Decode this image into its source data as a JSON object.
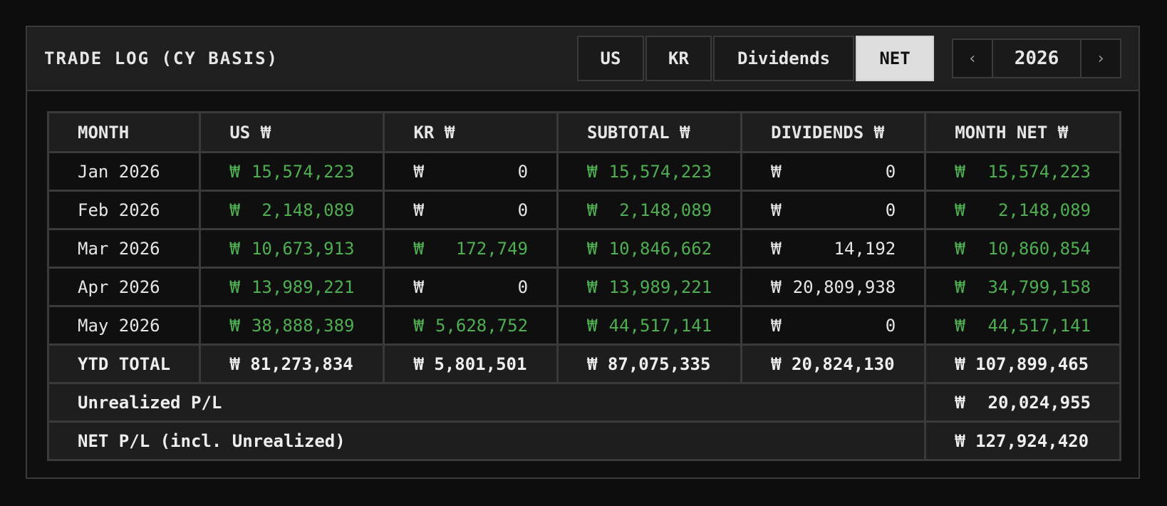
{
  "title": "TRADE LOG (CY BASIS)",
  "tabs": [
    {
      "label": "US",
      "active": false
    },
    {
      "label": "KR",
      "active": false
    },
    {
      "label": "Dividends",
      "active": false
    },
    {
      "label": "NET",
      "active": true
    }
  ],
  "year_nav": {
    "prev_icon": "‹",
    "year": "2026",
    "next_icon": "›"
  },
  "columns": [
    "MONTH",
    "US ₩",
    "KR ₩",
    "SUBTOTAL ₩",
    "DIVIDENDS ₩",
    "MONTH NET ₩"
  ],
  "currency_symbol": "₩",
  "rows": [
    {
      "month": "Jan 2026",
      "us": "15,574,223",
      "kr": "0",
      "subtotal": "15,574,223",
      "dividends": "0",
      "net": "15,574,223"
    },
    {
      "month": "Feb 2026",
      "us": "2,148,089",
      "kr": "0",
      "subtotal": "2,148,089",
      "dividends": "0",
      "net": "2,148,089"
    },
    {
      "month": "Mar 2026",
      "us": "10,673,913",
      "kr": "172,749",
      "subtotal": "10,846,662",
      "dividends": "14,192",
      "net": "10,860,854"
    },
    {
      "month": "Apr 2026",
      "us": "13,989,221",
      "kr": "0",
      "subtotal": "13,989,221",
      "dividends": "20,809,938",
      "net": "34,799,158"
    },
    {
      "month": "May 2026",
      "us": "38,888,389",
      "kr": "5,628,752",
      "subtotal": "44,517,141",
      "dividends": "0",
      "net": "44,517,141"
    }
  ],
  "ytd": {
    "label": "YTD TOTAL",
    "us": "₩ 81,273,834",
    "kr": "₩ 5,801,501",
    "subtotal": "₩ 87,075,335",
    "dividends": "₩ 20,824,130",
    "net": "₩ 107,899,465"
  },
  "unrealized": {
    "label": "Unrealized P/L",
    "symbol": "₩",
    "value": "20,024,955"
  },
  "net_pl": {
    "label": "NET P/L (incl. Unrealized)",
    "value": "₩ 127,924,420"
  },
  "colors": {
    "positive": "#4fae52",
    "neutral": "#e6e6e6",
    "active_tab_bg": "#dedede"
  }
}
